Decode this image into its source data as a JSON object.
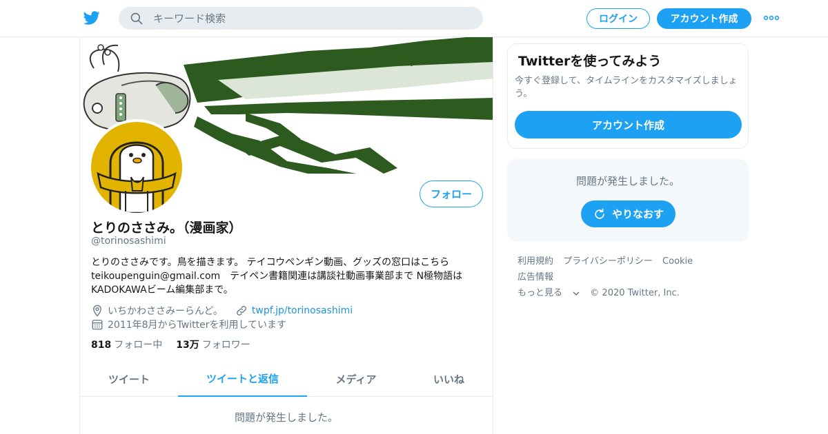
{
  "header": {
    "search_placeholder": "キーワード検索",
    "login_label": "ログイン",
    "signup_label": "アカウント作成"
  },
  "profile": {
    "name": "とりのささみ。（漫画家）",
    "handle": "@torinosashimi",
    "follow_label": "フォロー",
    "bio_lines": [
      "とりのささみです。鳥を描きます。 テイコウペンギン動画、グッズの窓口はこちら",
      "teikoupenguin@gmail.com　テイペン書籍関連は講談社動画事業部まで N極物語は",
      "KADOKAWAビーム編集部まで。"
    ],
    "location": "いちかわささみーらんど。",
    "website": "twpf.jp/torinosashimi",
    "joined": "2011年8月からTwitterを利用しています",
    "following_count": "818",
    "following_label": "フォロー中",
    "followers_count": "13万",
    "followers_label": "フォロワー"
  },
  "tabs": [
    {
      "label": "ツイート",
      "active": false
    },
    {
      "label": "ツイートと返信",
      "active": true
    },
    {
      "label": "メディア",
      "active": false
    },
    {
      "label": "いいね",
      "active": false
    }
  ],
  "timeline": {
    "error_message": "問題が発生しました。"
  },
  "signup_card": {
    "title": "Twitterを使ってみよう",
    "subtitle": "今すぐ登録して、タイムラインをカスタマイズしましょう。",
    "button_label": "アカウント作成"
  },
  "trends_card": {
    "error_message": "問題が発生しました。",
    "retry_label": "やりなおす"
  },
  "footer": {
    "links": [
      "利用規約",
      "プライバシーポリシー",
      "Cookie",
      "広告情報",
      "もっと見る"
    ],
    "copyright": "© 2020 Twitter, Inc."
  },
  "colors": {
    "accent": "#1da1f2",
    "text_secondary": "#657786",
    "border": "#e6ecf0",
    "banner_green": "#2d5a1e",
    "avatar_yellow": "#e2b400"
  }
}
